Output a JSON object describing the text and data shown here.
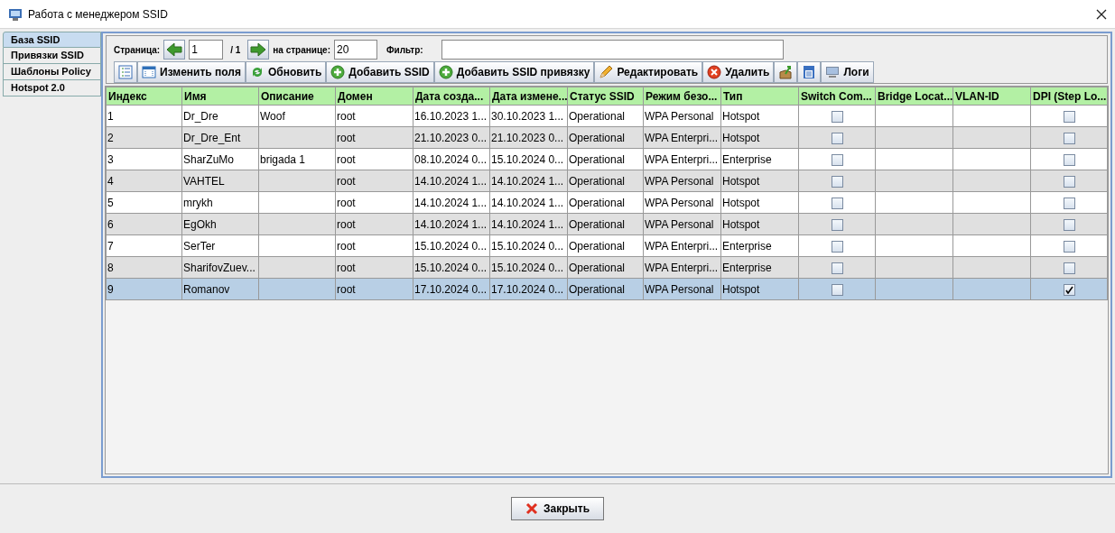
{
  "window": {
    "title": "Работа с менеджером SSID"
  },
  "tabs": [
    {
      "label": "База SSID",
      "selected": true
    },
    {
      "label": "Привязки SSID",
      "selected": false
    },
    {
      "label": "Шаблоны Policy",
      "selected": false
    },
    {
      "label": "Hotspot 2.0",
      "selected": false
    }
  ],
  "pager": {
    "page_label": "Страница:",
    "page": "1",
    "total": "/ 1",
    "per_page_label": "на странице:",
    "per_page": "20",
    "filter_label": "Фильтр:"
  },
  "toolbar": [
    {
      "kind": "columns"
    },
    {
      "kind": "fields",
      "label": "Изменить поля"
    },
    {
      "kind": "refresh",
      "label": "Обновить"
    },
    {
      "kind": "add",
      "label": "Добавить SSID"
    },
    {
      "kind": "add",
      "label": "Добавить SSID привязку"
    },
    {
      "kind": "edit",
      "label": "Редактировать"
    },
    {
      "kind": "delete",
      "label": "Удалить"
    },
    {
      "kind": "export"
    },
    {
      "kind": "save"
    },
    {
      "kind": "logs",
      "label": "Логи"
    }
  ],
  "table": {
    "columns": [
      {
        "label": "Индекс",
        "kind": "text"
      },
      {
        "label": "Имя",
        "kind": "text"
      },
      {
        "label": "Описание",
        "kind": "text"
      },
      {
        "label": "Домен",
        "kind": "text"
      },
      {
        "label": "Дата созда...",
        "kind": "text"
      },
      {
        "label": "Дата измене...",
        "kind": "text"
      },
      {
        "label": "Статус SSID",
        "kind": "text"
      },
      {
        "label": "Режим безо...",
        "kind": "text"
      },
      {
        "label": "Тип",
        "kind": "text"
      },
      {
        "label": "Switch Com...",
        "kind": "check"
      },
      {
        "label": "Bridge Locat...",
        "kind": "text"
      },
      {
        "label": "VLAN-ID",
        "kind": "text"
      },
      {
        "label": "DPI (Step Lo...",
        "kind": "check"
      }
    ],
    "rows": [
      {
        "selected": false,
        "cells": [
          "1",
          "Dr_Dre",
          "Woof",
          "root",
          "16.10.2023 1...",
          "30.10.2023 1...",
          "Operational",
          "WPA Personal",
          "Hotspot",
          false,
          "",
          "",
          false
        ]
      },
      {
        "selected": false,
        "cells": [
          "2",
          "Dr_Dre_Ent",
          "",
          "root",
          "21.10.2023 0...",
          "21.10.2023 0...",
          "Operational",
          "WPA Enterpri...",
          "Hotspot",
          false,
          "",
          "",
          false
        ]
      },
      {
        "selected": false,
        "cells": [
          "3",
          "SharZuMo",
          "brigada 1",
          "root",
          "08.10.2024 0...",
          "15.10.2024 0...",
          "Operational",
          "WPA Enterpri...",
          "Enterprise",
          false,
          "",
          "",
          false
        ]
      },
      {
        "selected": false,
        "cells": [
          "4",
          "VAHTEL",
          "",
          "root",
          "14.10.2024 1...",
          "14.10.2024 1...",
          "Operational",
          "WPA Personal",
          "Hotspot",
          false,
          "",
          "",
          false
        ]
      },
      {
        "selected": false,
        "cells": [
          "5",
          "mrykh",
          "",
          "root",
          "14.10.2024 1...",
          "14.10.2024 1...",
          "Operational",
          "WPA Personal",
          "Hotspot",
          false,
          "",
          "",
          false
        ]
      },
      {
        "selected": false,
        "cells": [
          "6",
          "EgOkh",
          "",
          "root",
          "14.10.2024 1...",
          "14.10.2024 1...",
          "Operational",
          "WPA Personal",
          "Hotspot",
          false,
          "",
          "",
          false
        ]
      },
      {
        "selected": false,
        "cells": [
          "7",
          "SerTer",
          "",
          "root",
          "15.10.2024 0...",
          "15.10.2024 0...",
          "Operational",
          "WPA Enterpri...",
          "Enterprise",
          false,
          "",
          "",
          false
        ]
      },
      {
        "selected": false,
        "cells": [
          "8",
          "SharifovZuev...",
          "",
          "root",
          "15.10.2024 0...",
          "15.10.2024 0...",
          "Operational",
          "WPA Enterpri...",
          "Enterprise",
          false,
          "",
          "",
          false
        ]
      },
      {
        "selected": true,
        "cells": [
          "9",
          "Romanov",
          "",
          "root",
          "17.10.2024 0...",
          "17.10.2024 0...",
          "Operational",
          "WPA Personal",
          "Hotspot",
          false,
          "",
          "",
          true
        ]
      }
    ]
  },
  "close_button": {
    "label": "Закрыть"
  }
}
